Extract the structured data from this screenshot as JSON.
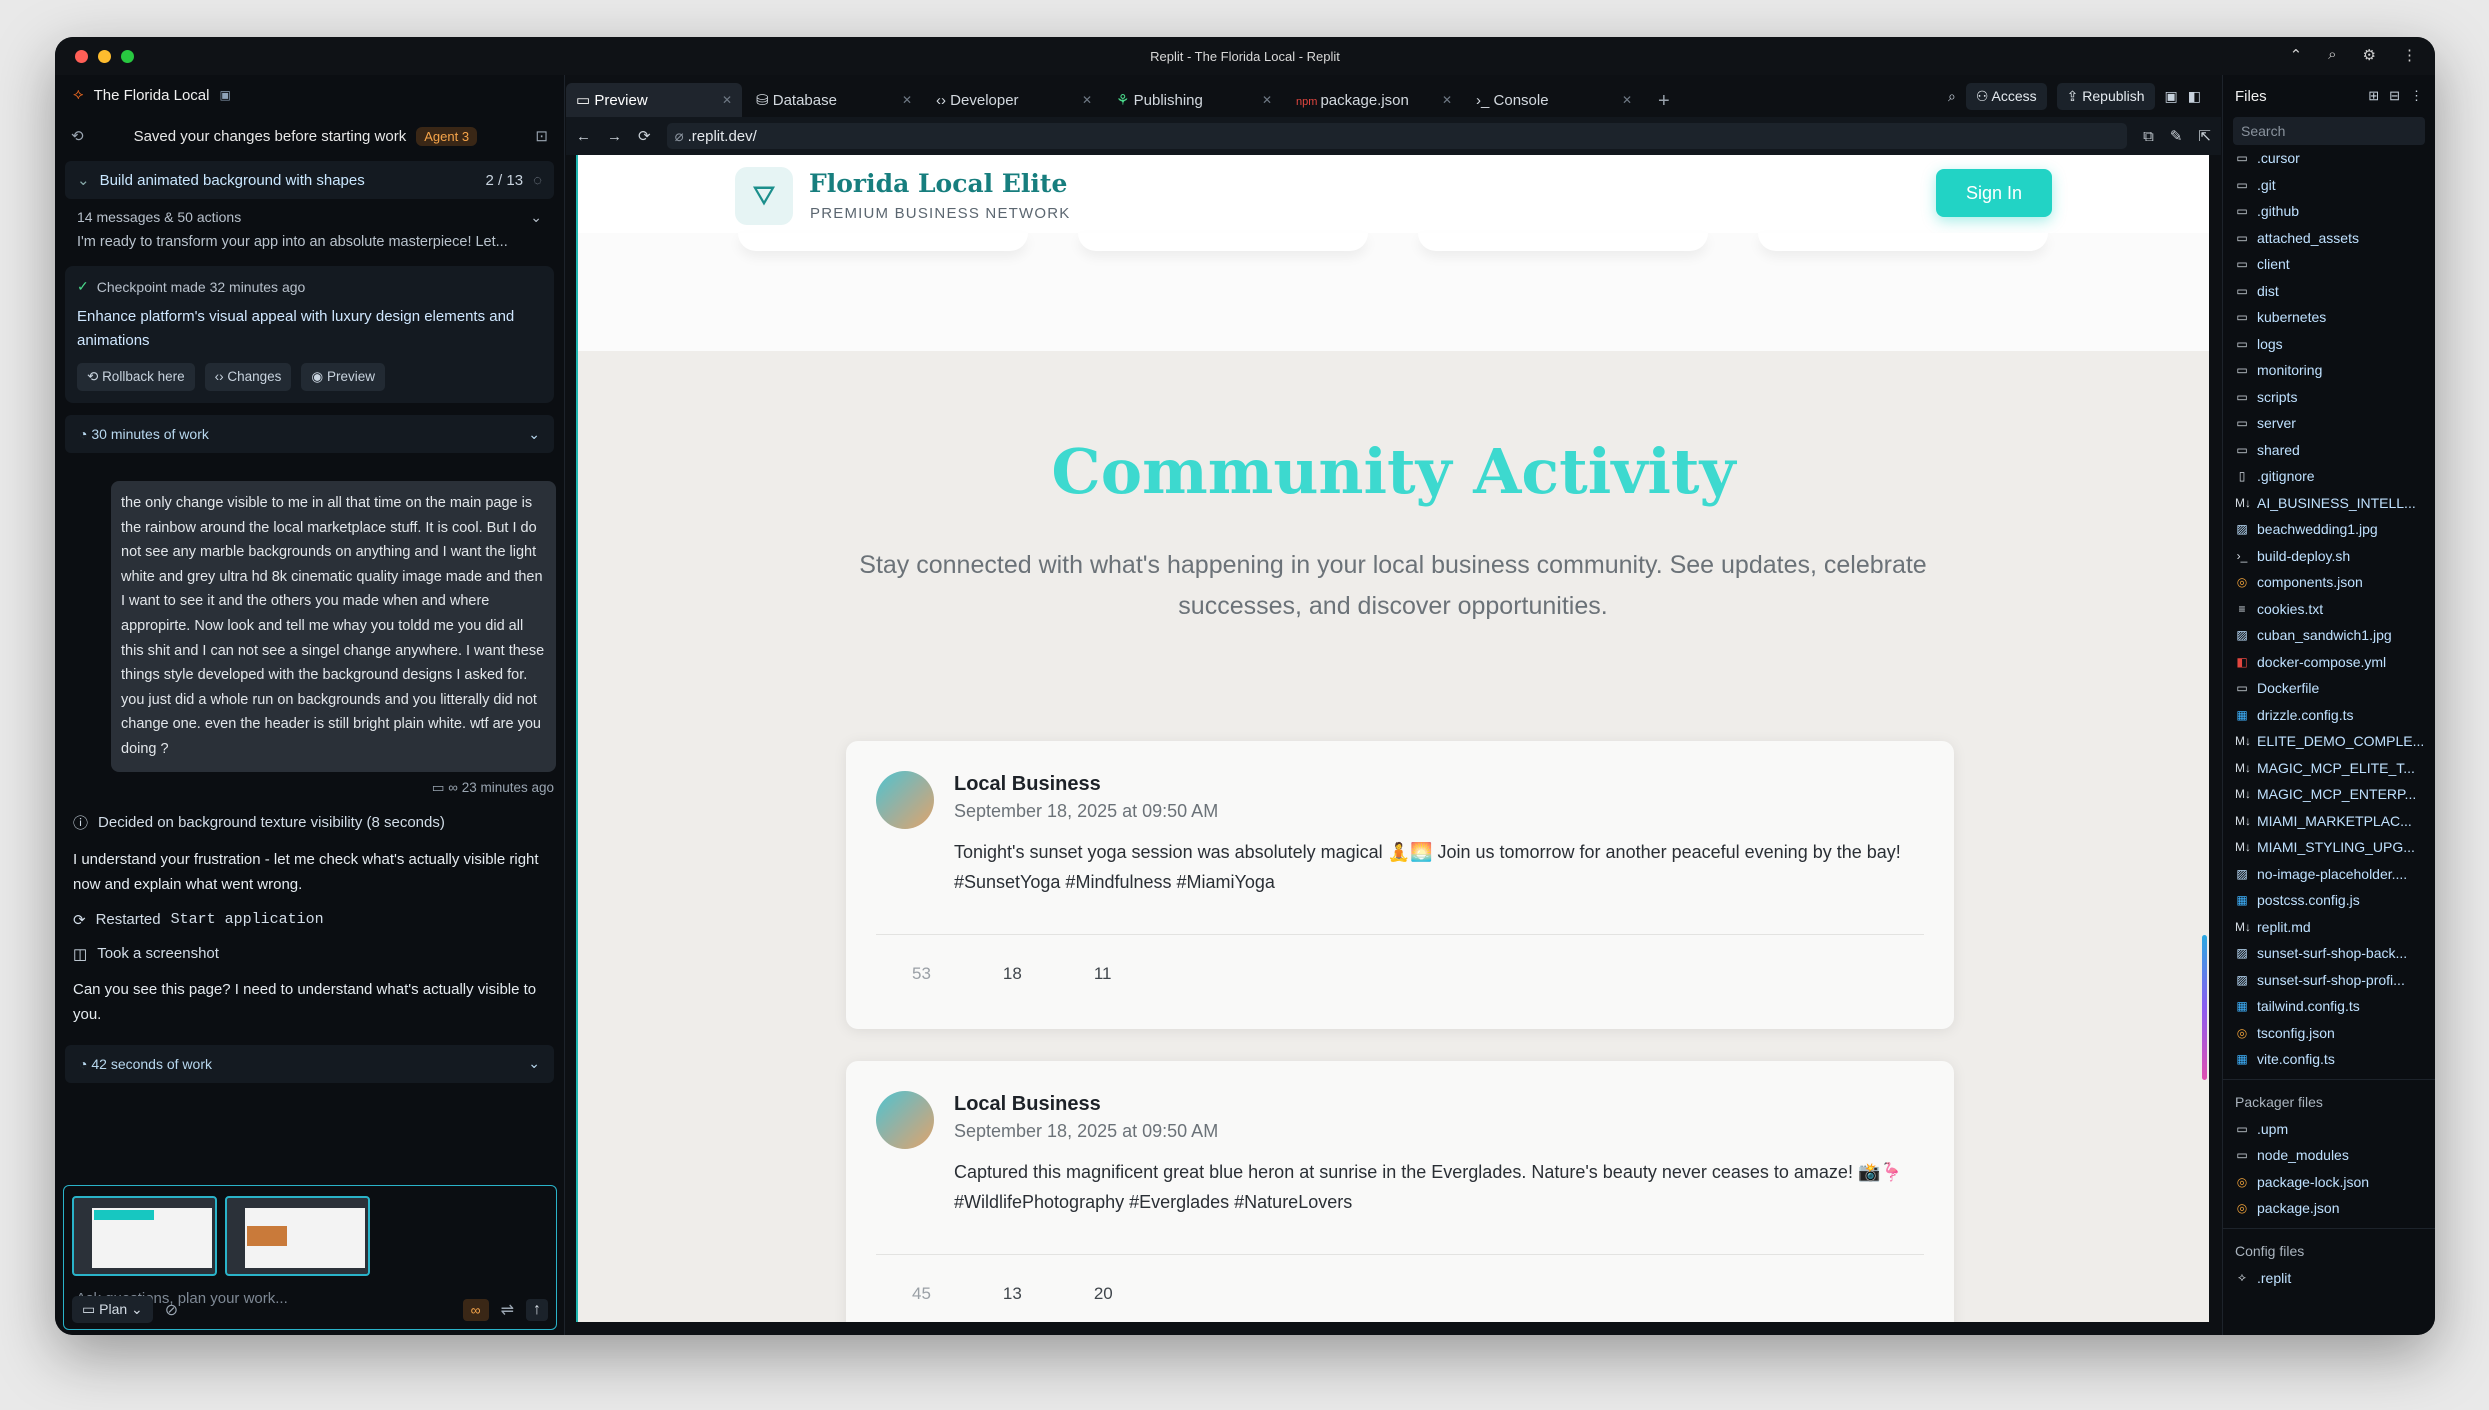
{
  "window": {
    "title": "Replit - The Florida Local - Replit"
  },
  "left": {
    "project_name": "The Florida Local",
    "saved_text": "Saved your changes before starting work",
    "agent_badge": "Agent 3",
    "task": {
      "title": "Build animated background with shapes",
      "progress": "2 / 13"
    },
    "summary": {
      "counts": "14 messages & 50 actions",
      "preview": "I'm ready to transform your app into an absolute masterpiece! Let..."
    },
    "checkpoint": {
      "made": "Checkpoint made 32 minutes ago",
      "title": "Enhance platform's visual appeal with luxury design elements and animations",
      "rollback": "Rollback here",
      "changes": "Changes",
      "preview": "Preview"
    },
    "work1": "30 minutes of work",
    "user_message": "the only change visible to me in all that time on the main page is the rainbow around the local marketplace stuff. It is cool. But I do not see any marble backgrounds on anything and I want the light white and grey ultra hd 8k cinematic quality image made and then I want to see it and the others you made when and where appropirte. Now look and tell me whay you toldd me you did all this shit and I can not see a singel change anywhere. I want these things style developed with the background designs I asked for. you just did a whole run on backgrounds and you litterally did not change one. even the header is still bright plain white. wtf are you doing ?",
    "user_time": "23 minutes ago",
    "decided": "Decided on background texture visibility (8 seconds)",
    "assistant1": "I understand your frustration - let me check what's actually visible right now and explain what went wrong.",
    "restarted": "Restarted",
    "restarted_cmd": "Start application",
    "screenshot": "Took a screenshot",
    "assistant2": "Can you see this page? I need to understand what's actually visible to you.",
    "work2": "42 seconds of work",
    "composer_placeholder": "Ask questions, plan your work...",
    "plan_label": "Plan"
  },
  "tabs": [
    {
      "label": "Preview",
      "icon": "monitor-icon",
      "active": true
    },
    {
      "label": "Database",
      "icon": "database-icon"
    },
    {
      "label": "Developer",
      "icon": "code-icon"
    },
    {
      "label": "Publishing",
      "icon": "rocket-icon"
    },
    {
      "label": "package.json",
      "icon": "npm-icon"
    },
    {
      "label": "Console",
      "icon": "terminal-icon"
    }
  ],
  "toolbar": {
    "access": "Access",
    "republish": "Republish"
  },
  "url": ".replit.dev/",
  "site": {
    "name": "Florida Local Elite",
    "subtitle": "PREMIUM BUSINESS NETWORK",
    "sign_in": "Sign In",
    "section_title": "Community Activity",
    "section_subtitle": "Stay connected with what's happening in your local business community. See updates, celebrate successes, and discover opportunities.",
    "posts": [
      {
        "author": "Local Business",
        "date": "September 18, 2025 at 09:50 AM",
        "text": "Tonight's sunset yoga session was absolutely magical 🧘🌅 Join us tomorrow for another peaceful evening by the bay! #SunsetYoga #Mindfulness #MiamiYoga",
        "likes": "53",
        "comments": "18",
        "shares": "11"
      },
      {
        "author": "Local Business",
        "date": "September 18, 2025 at 09:50 AM",
        "text": "Captured this magnificent great blue heron at sunrise in the Everglades. Nature's beauty never ceases to amaze! 📸🦩 #WildlifePhotography #Everglades #NatureLovers",
        "likes": "45",
        "comments": "13",
        "shares": "20"
      }
    ]
  },
  "files": {
    "title": "Files",
    "search_placeholder": "Search",
    "items": [
      ".cursor",
      ".git",
      ".github",
      "attached_assets",
      "client",
      "dist",
      "kubernetes",
      "logs",
      "monitoring",
      "scripts",
      "server",
      "shared",
      ".gitignore",
      "AI_BUSINESS_INTELL...",
      "beachwedding1.jpg",
      "build-deploy.sh",
      "components.json",
      "cookies.txt",
      "cuban_sandwich1.jpg",
      "docker-compose.yml",
      "Dockerfile",
      "drizzle.config.ts",
      "ELITE_DEMO_COMPLE...",
      "MAGIC_MCP_ELITE_T...",
      "MAGIC_MCP_ENTERP...",
      "MIAMI_MARKETPLAC...",
      "MIAMI_STYLING_UPG...",
      "no-image-placeholder....",
      "postcss.config.js",
      "replit.md",
      "sunset-surf-shop-back...",
      "sunset-surf-shop-profi...",
      "tailwind.config.ts",
      "tsconfig.json",
      "vite.config.ts"
    ],
    "packager_label": "Packager files",
    "packager_items": [
      ".upm",
      "node_modules",
      "package-lock.json",
      "package.json"
    ],
    "config_label": "Config files",
    "config_items": [
      ".replit"
    ]
  }
}
